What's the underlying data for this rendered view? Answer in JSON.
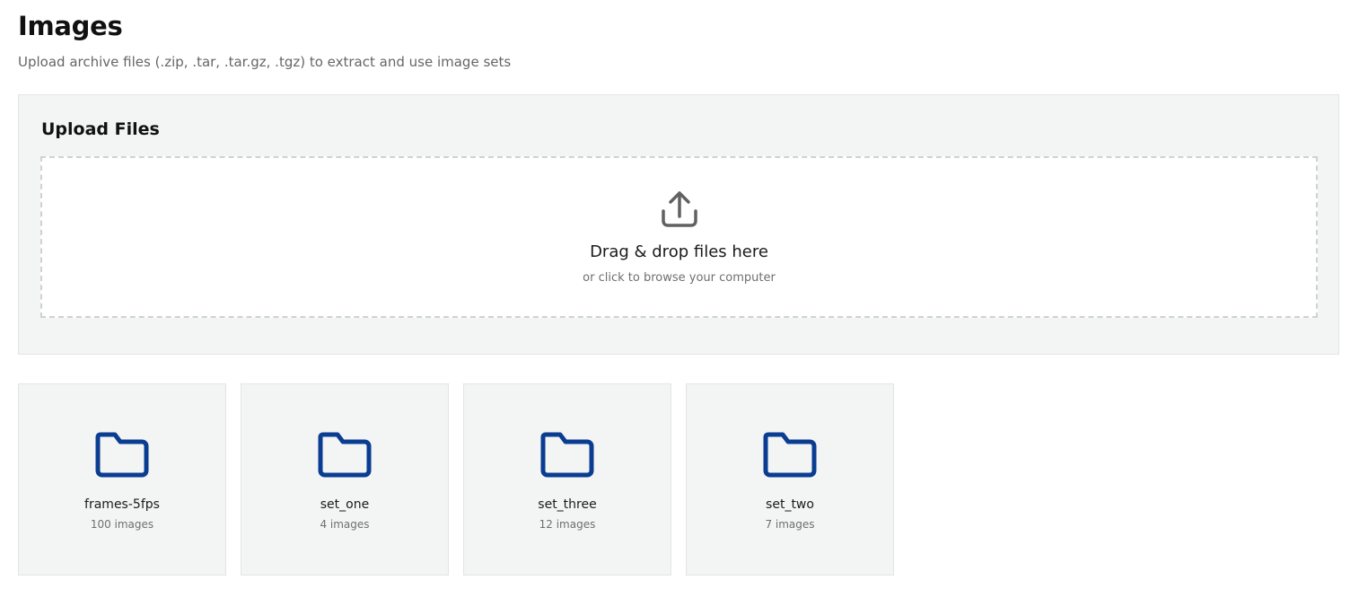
{
  "page": {
    "title": "Images",
    "subtitle": "Upload archive files (.zip, .tar, .tar.gz, .tgz) to extract and use image sets"
  },
  "upload": {
    "title": "Upload Files",
    "icon": "upload-icon",
    "main_text": "Drag & drop files here",
    "sub_text": "or click to browse your computer"
  },
  "colors": {
    "folder_icon": "#0a3d91",
    "upload_icon": "#616161",
    "card_background": "#f3f4f4"
  },
  "folders": [
    {
      "name": "frames-5fps",
      "count": "100 images",
      "icon": "folder-icon"
    },
    {
      "name": "set_one",
      "count": "4 images",
      "icon": "folder-icon"
    },
    {
      "name": "set_three",
      "count": "12 images",
      "icon": "folder-icon"
    },
    {
      "name": "set_two",
      "count": "7 images",
      "icon": "folder-icon"
    }
  ]
}
